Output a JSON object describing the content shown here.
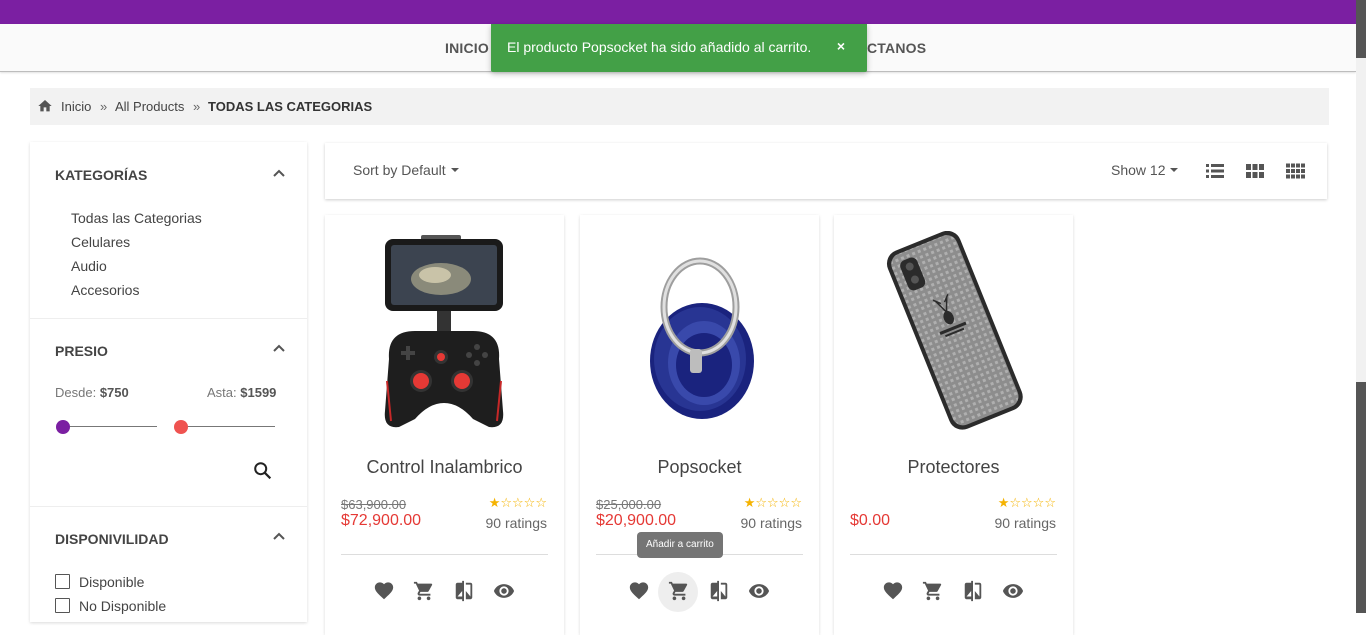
{
  "nav": {
    "inicio": "INICIO",
    "contactanos_partial": "CTANOS"
  },
  "toast": {
    "message": "El producto Popsocket ha sido añadido al carrito.",
    "close": "×"
  },
  "breadcrumb": {
    "items": [
      "Inicio",
      "All Products",
      "TODAS LAS CATEGORIAS"
    ],
    "separator": "»"
  },
  "sidebar": {
    "categories_title": "KATEGORÍAS",
    "categories": [
      "Todas las Categorias",
      "Celulares",
      "Audio",
      "Accesorios"
    ],
    "price_title": "PRESIO",
    "price_from_label": "Desde:",
    "price_from_value": "$750",
    "price_to_label": "Asta:",
    "price_to_value": "$1599",
    "availability_title": "DISPONIVILIDAD",
    "availability": [
      "Disponible",
      "No Disponible"
    ]
  },
  "toolbar": {
    "sort_label": "Sort by Default",
    "show_label": "Show 12"
  },
  "products": [
    {
      "name": "Control Inalambrico",
      "old_price": "$63,900.00",
      "price": "$72,900.00",
      "stars": "★☆☆☆☆",
      "rating": 1,
      "ratings": "90 ratings"
    },
    {
      "name": "Popsocket",
      "old_price": "$25,000.00",
      "price": "$20,900.00",
      "stars": "★☆☆☆☆",
      "rating": 1,
      "ratings": "90 ratings"
    },
    {
      "name": "Protectores",
      "old_price": "",
      "price": "$0.00",
      "stars": "★☆☆☆☆",
      "rating": 1,
      "ratings": "90 ratings"
    }
  ],
  "tooltip": "Añadir a carrito",
  "colors": {
    "brand_purple": "#7b1fa2",
    "toast_green": "#43a047",
    "price_red": "#e53935",
    "star_gold": "#f5b301",
    "slider_min_knob": "#7b1fa2",
    "slider_max_knob": "#ef5350"
  }
}
